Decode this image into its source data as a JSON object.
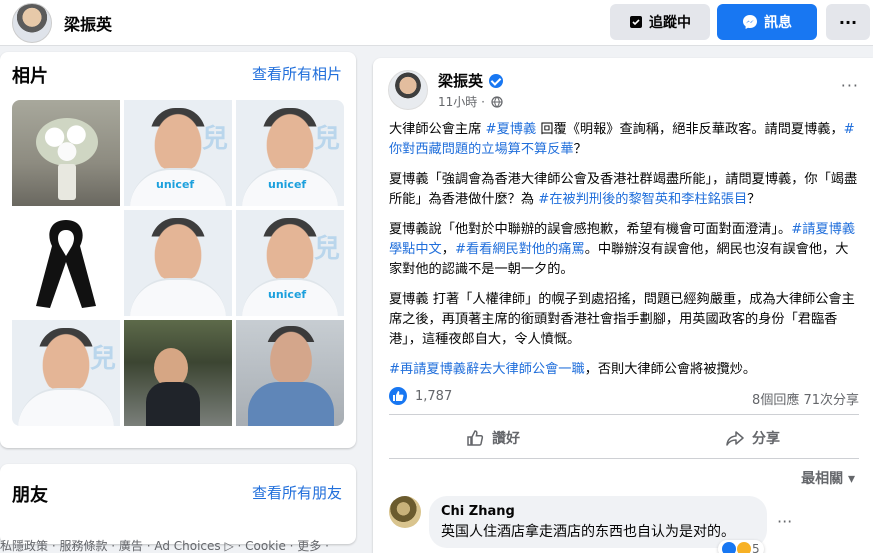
{
  "header": {
    "page_name": "梁振英",
    "follow_label": "追蹤中",
    "message_label": "訊息",
    "more_label": "···"
  },
  "photos": {
    "title": "相片",
    "see_all": "查看所有相片",
    "items": [
      {
        "kind": "flowers"
      },
      {
        "kind": "unicef",
        "logo": "unicef"
      },
      {
        "kind": "unicef",
        "logo": "unicef"
      },
      {
        "kind": "black-ribbon"
      },
      {
        "kind": "unicef",
        "logo": ""
      },
      {
        "kind": "unicef",
        "logo": "unicef"
      },
      {
        "kind": "unicef",
        "logo": ""
      },
      {
        "kind": "work"
      },
      {
        "kind": "cafe"
      }
    ]
  },
  "friends": {
    "title": "朋友",
    "see_all": "查看所有朋友"
  },
  "footer": {
    "links": "私隱政策 · 服務條款 · 廣告 · Ad Choices ▷ · Cookie · 更多 ·"
  },
  "post": {
    "author": "梁振英",
    "time": "11小時 ·",
    "menu": "···",
    "p1_pre": "大律師公會主席 ",
    "p1_tag1": "#夏博義",
    "p1_mid": " 回覆《明報》查詢稱，絕非反華政客。請問夏博義，",
    "p1_tag2": "#你對西藏問題的立場算不算反華",
    "p1_post": "？",
    "p2_pre": "夏博義「強調會為香港大律師公會及香港社群竭盡所能」，請問夏博義，你「竭盡所能」為香港做什麼？為 ",
    "p2_tag": "#在被判刑後的黎智英和李柱銘張目",
    "p2_post": "？",
    "p3_pre": "夏博義說「他對於中聯辦的誤會感抱歉，希望有機會可面對面澄清」。",
    "p3_tag1": "#請夏博義學點中文",
    "p3_sep": "，",
    "p3_tag2": "#看看網民對他的痛罵",
    "p3_post": "。中聯辦沒有誤會他，網民也沒有誤會他，大家對他的認識不是一朝一夕的。",
    "p4": "夏博義 打著「人權律師」的幌子到處招搖，問題已經夠嚴重，成為大律師公會主席之後，再頂著主席的銜頭對香港社會指手劃腳，用英國政客的身份「君臨香港」，這種夜郎自大，令人憤慨。",
    "p5_tag": "#再請夏博義辭去大律師公會一職",
    "p5_post": "，否則大律師公會將被攬炒。",
    "reaction_count": "1,787",
    "comments_shares": "8個回應  71次分享",
    "like_label": "讚好",
    "share_label": "分享",
    "sort_label": "最相關 ▾"
  },
  "comment": {
    "author": "Chi Zhang",
    "text": "英国人住酒店拿走酒店的东西也自认为是对的。",
    "more": "···",
    "reaction_count": "5"
  },
  "colors": {
    "accent": "#1877f2",
    "link": "#216fdb",
    "background": "#f0f2f5",
    "muted": "#65676b"
  }
}
